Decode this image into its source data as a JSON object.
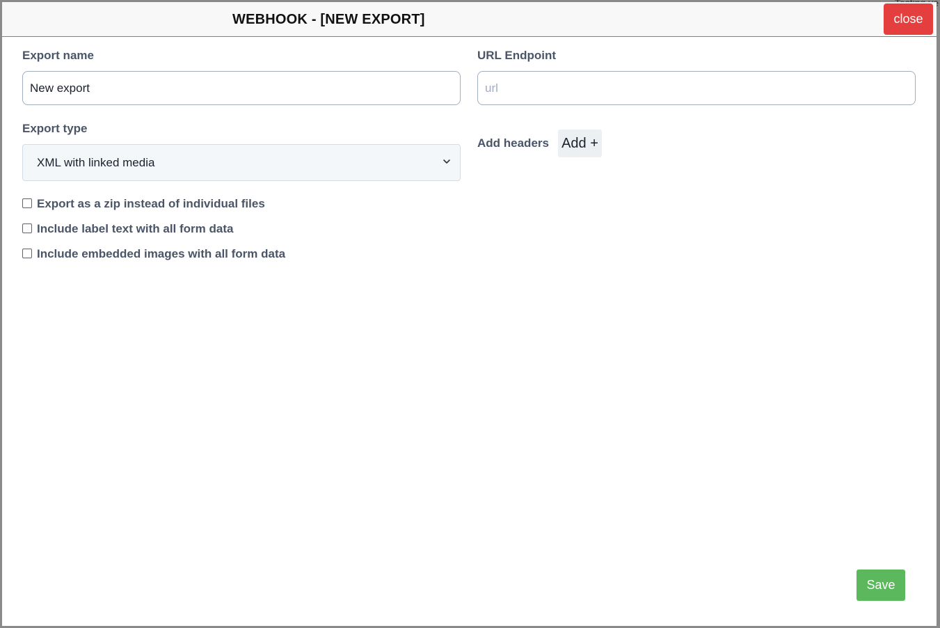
{
  "background": {
    "fragment_text": "Testing ve"
  },
  "modal": {
    "title": "WEBHOOK - [NEW EXPORT]",
    "close_label": "close"
  },
  "form": {
    "export_name": {
      "label": "Export name",
      "value": "New export"
    },
    "url_endpoint": {
      "label": "URL Endpoint",
      "value": "",
      "placeholder": "url"
    },
    "export_type": {
      "label": "Export type",
      "selected": "XML with linked media"
    },
    "headers": {
      "label": "Add headers",
      "add_label": "Add +"
    },
    "options": [
      {
        "label": "Export as a zip instead of individual files",
        "checked": false
      },
      {
        "label": "Include label text with all form data",
        "checked": false
      },
      {
        "label": "Include embedded images with all form data",
        "checked": false
      }
    ]
  },
  "footer": {
    "save_label": "Save"
  },
  "colors": {
    "close_button": "#e53e3e",
    "save_button": "#5cb85c",
    "label_text": "#4a5568"
  }
}
